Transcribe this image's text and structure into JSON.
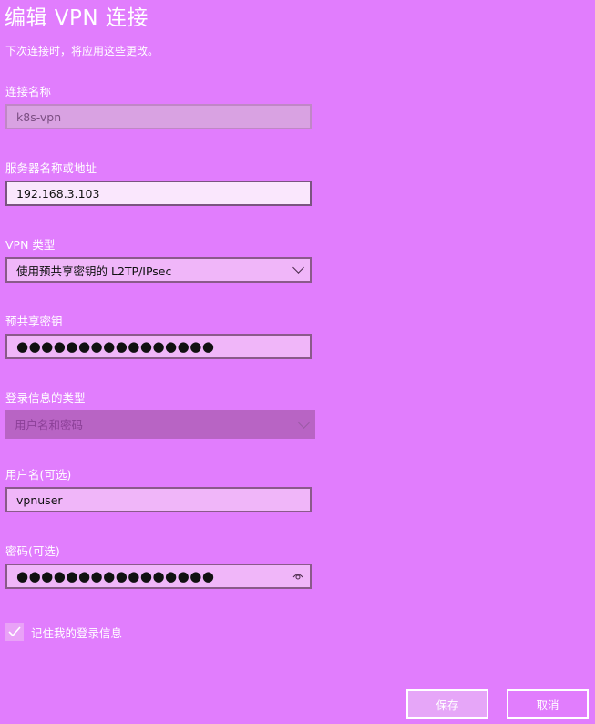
{
  "title": "编辑 VPN 连接",
  "subtitle": "下次连接时，将应用这些更改。",
  "fields": {
    "connection_name": {
      "label": "连接名称",
      "value": "k8s-vpn"
    },
    "server": {
      "label": "服务器名称或地址",
      "value": "192.168.3.103"
    },
    "vpn_type": {
      "label": "VPN 类型",
      "value": "使用预共享密钥的 L2TP/IPsec"
    },
    "psk": {
      "label": "预共享密钥",
      "value": "●●●●●●●●●●●●●●●●"
    },
    "signin_type": {
      "label": "登录信息的类型",
      "value": "用户名和密码"
    },
    "username": {
      "label": "用户名(可选)",
      "value": "vpnuser"
    },
    "password": {
      "label": "密码(可选)",
      "value": "●●●●●●●●●●●●●●●●"
    }
  },
  "remember": {
    "label": "记住我的登录信息",
    "checked": true
  },
  "buttons": {
    "save": "保存",
    "cancel": "取消"
  }
}
